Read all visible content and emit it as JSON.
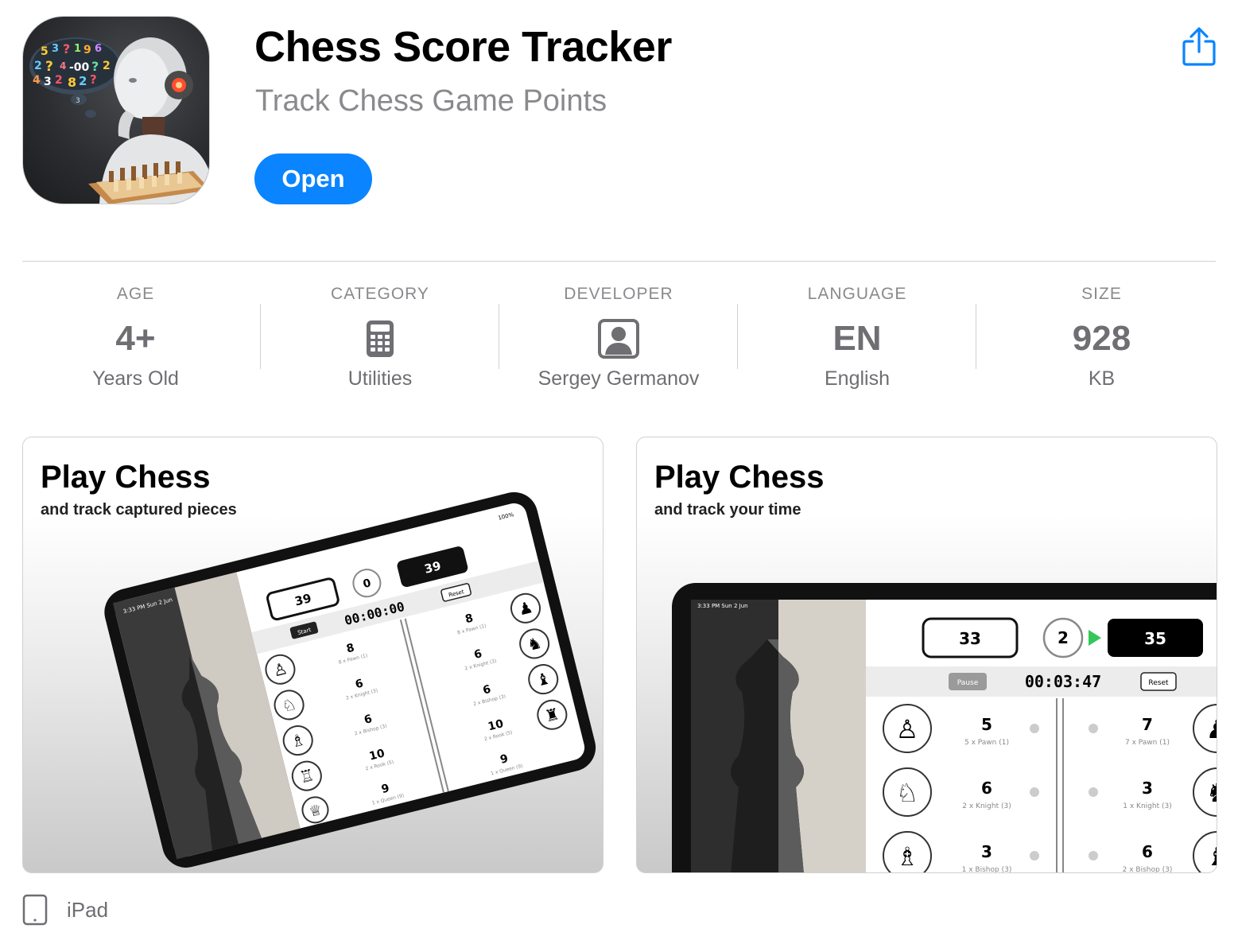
{
  "app": {
    "title": "Chess Score Tracker",
    "subtitle": "Track Chess Game Points",
    "open_label": "Open",
    "icon_text": "5 3 ? 1 9 6 ? 3 2 4 ?",
    "accent_color": "#0a84ff"
  },
  "info": [
    {
      "label": "AGE",
      "value": "4+",
      "sub": "Years Old"
    },
    {
      "label": "CATEGORY",
      "icon": "calculator-icon",
      "sub": "Utilities"
    },
    {
      "label": "DEVELOPER",
      "icon": "person-icon",
      "sub": "Sergey Germanov"
    },
    {
      "label": "LANGUAGE",
      "value": "EN",
      "sub": "English"
    },
    {
      "label": "SIZE",
      "value": "928",
      "sub": "KB"
    }
  ],
  "screenshots": [
    {
      "title": "Play Chess",
      "subtitle": "and track captured pieces",
      "status": "3:33 PM  Sun 2 Jun",
      "battery": "100%",
      "score_left": "39",
      "score_mid": "0",
      "score_right": "39",
      "timer": "00:00:00",
      "start_label": "Start",
      "reset_label": "Reset",
      "left_rows": [
        {
          "value": "8",
          "caption": "8 x Pawn (1)"
        },
        {
          "value": "6",
          "caption": "2 x Knight (3)"
        },
        {
          "value": "6",
          "caption": "2 x Bishop (3)"
        },
        {
          "value": "10",
          "caption": "2 x Rook (5)"
        },
        {
          "value": "9",
          "caption": "1 x Queen (9)"
        }
      ],
      "right_rows": [
        {
          "value": "8",
          "caption": "8 x Pawn (1)"
        },
        {
          "value": "6",
          "caption": "2 x Knight (3)"
        },
        {
          "value": "6",
          "caption": "2 x Bishop (3)"
        },
        {
          "value": "10",
          "caption": "2 x Rook (5)"
        },
        {
          "value": "9",
          "caption": "1 x Queen (9)"
        }
      ]
    },
    {
      "title": "Play Chess",
      "subtitle": "and track your time",
      "status": "3:33 PM  Sun 2 Jun",
      "score_left": "33",
      "score_mid": "2",
      "score_right": "35",
      "timer": "00:03:47",
      "pause_label": "Pause",
      "reset_label": "Reset",
      "left_rows": [
        {
          "value": "5",
          "caption": "5 x Pawn (1)"
        },
        {
          "value": "6",
          "caption": "2 x Knight (3)"
        },
        {
          "value": "3",
          "caption": "1 x Bishop (3)"
        }
      ],
      "right_rows": [
        {
          "value": "7",
          "caption": "7 x Pawn (1)"
        },
        {
          "value": "3",
          "caption": "1 x Knight (3)"
        },
        {
          "value": "6",
          "caption": "2 x Bishop (3)"
        }
      ]
    }
  ],
  "device": {
    "label": "iPad",
    "icon": "ipad-icon"
  }
}
